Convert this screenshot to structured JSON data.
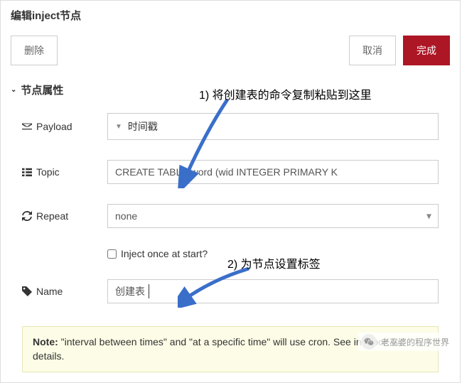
{
  "header": {
    "title": "编辑inject节点"
  },
  "buttons": {
    "delete": "删除",
    "cancel": "取消",
    "done": "完成"
  },
  "section": {
    "title": "节点属性"
  },
  "annotations": {
    "a1": "1) 将创建表的命令复制粘贴到这里",
    "a2": "2) 为节点设置标签"
  },
  "fields": {
    "payload": {
      "label": "Payload",
      "value": "时间戳"
    },
    "topic": {
      "label": "Topic",
      "value": "CREATE TABLE word (wid INTEGER PRIMARY K"
    },
    "repeat": {
      "label": "Repeat",
      "value": "none"
    },
    "inject_once": {
      "label": "Inject once at start?"
    },
    "name": {
      "label": "Name",
      "value": "创建表"
    }
  },
  "note": {
    "bold": "Note:",
    "text": " \"interval between times\" and \"at a specific time\" will use cron. See info box for details."
  },
  "watermark": {
    "text": "老巫婆的程序世界"
  }
}
